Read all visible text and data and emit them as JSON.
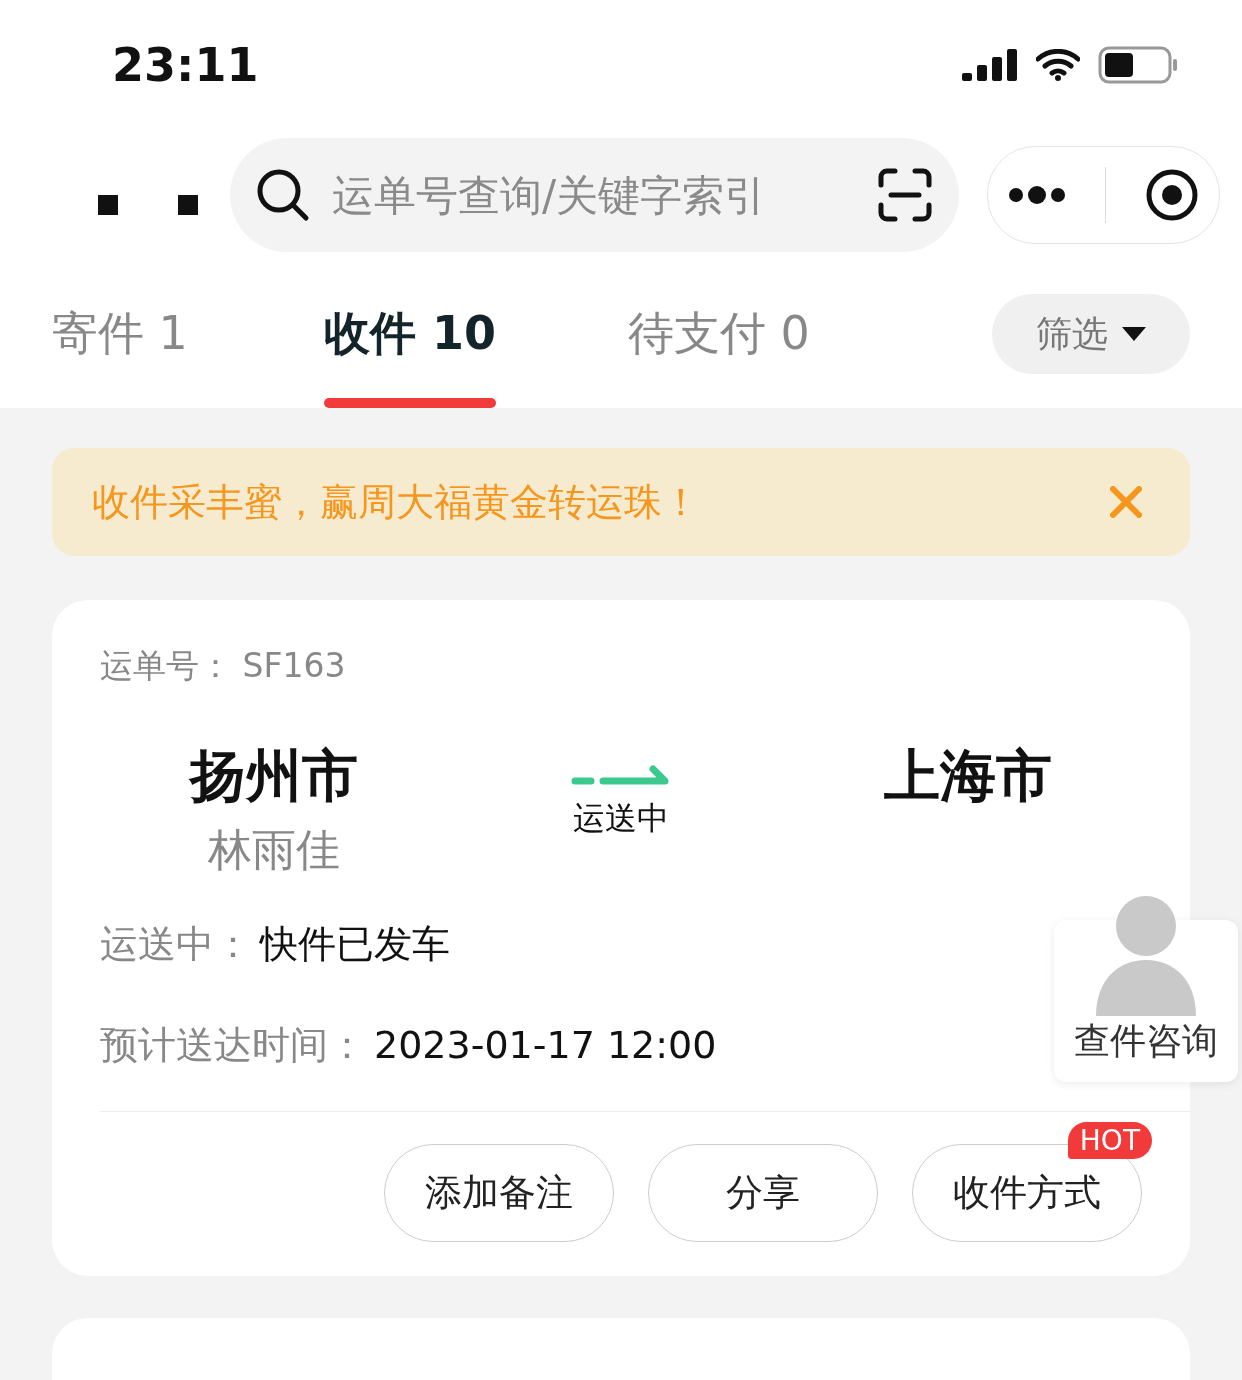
{
  "status_bar": {
    "time": "23:11"
  },
  "search": {
    "placeholder": "运单号查询/关键字索引"
  },
  "tabs": [
    {
      "label": "寄件 1",
      "selected": false
    },
    {
      "label": "收件 10",
      "selected": true
    },
    {
      "label": "待支付 0",
      "selected": false
    }
  ],
  "filter": {
    "label": "筛选"
  },
  "banner": {
    "text": "收件采丰蜜，赢周大福黄金转运珠！"
  },
  "card": {
    "waybill_label": "运单号：",
    "waybill_number": "SF163",
    "origin": "扬州市",
    "sender": "林雨佳",
    "destination": "上海市",
    "status": "运送中",
    "details": [
      {
        "label": "运送中：",
        "value": "快件已发车"
      },
      {
        "label": "预计送达时间：",
        "value": "2023-01-17 12:00"
      }
    ],
    "actions": [
      {
        "label": "添加备注"
      },
      {
        "label": "分享"
      },
      {
        "label": "收件方式",
        "badge": "HOT"
      }
    ]
  },
  "consult": {
    "label": "查件咨询"
  }
}
